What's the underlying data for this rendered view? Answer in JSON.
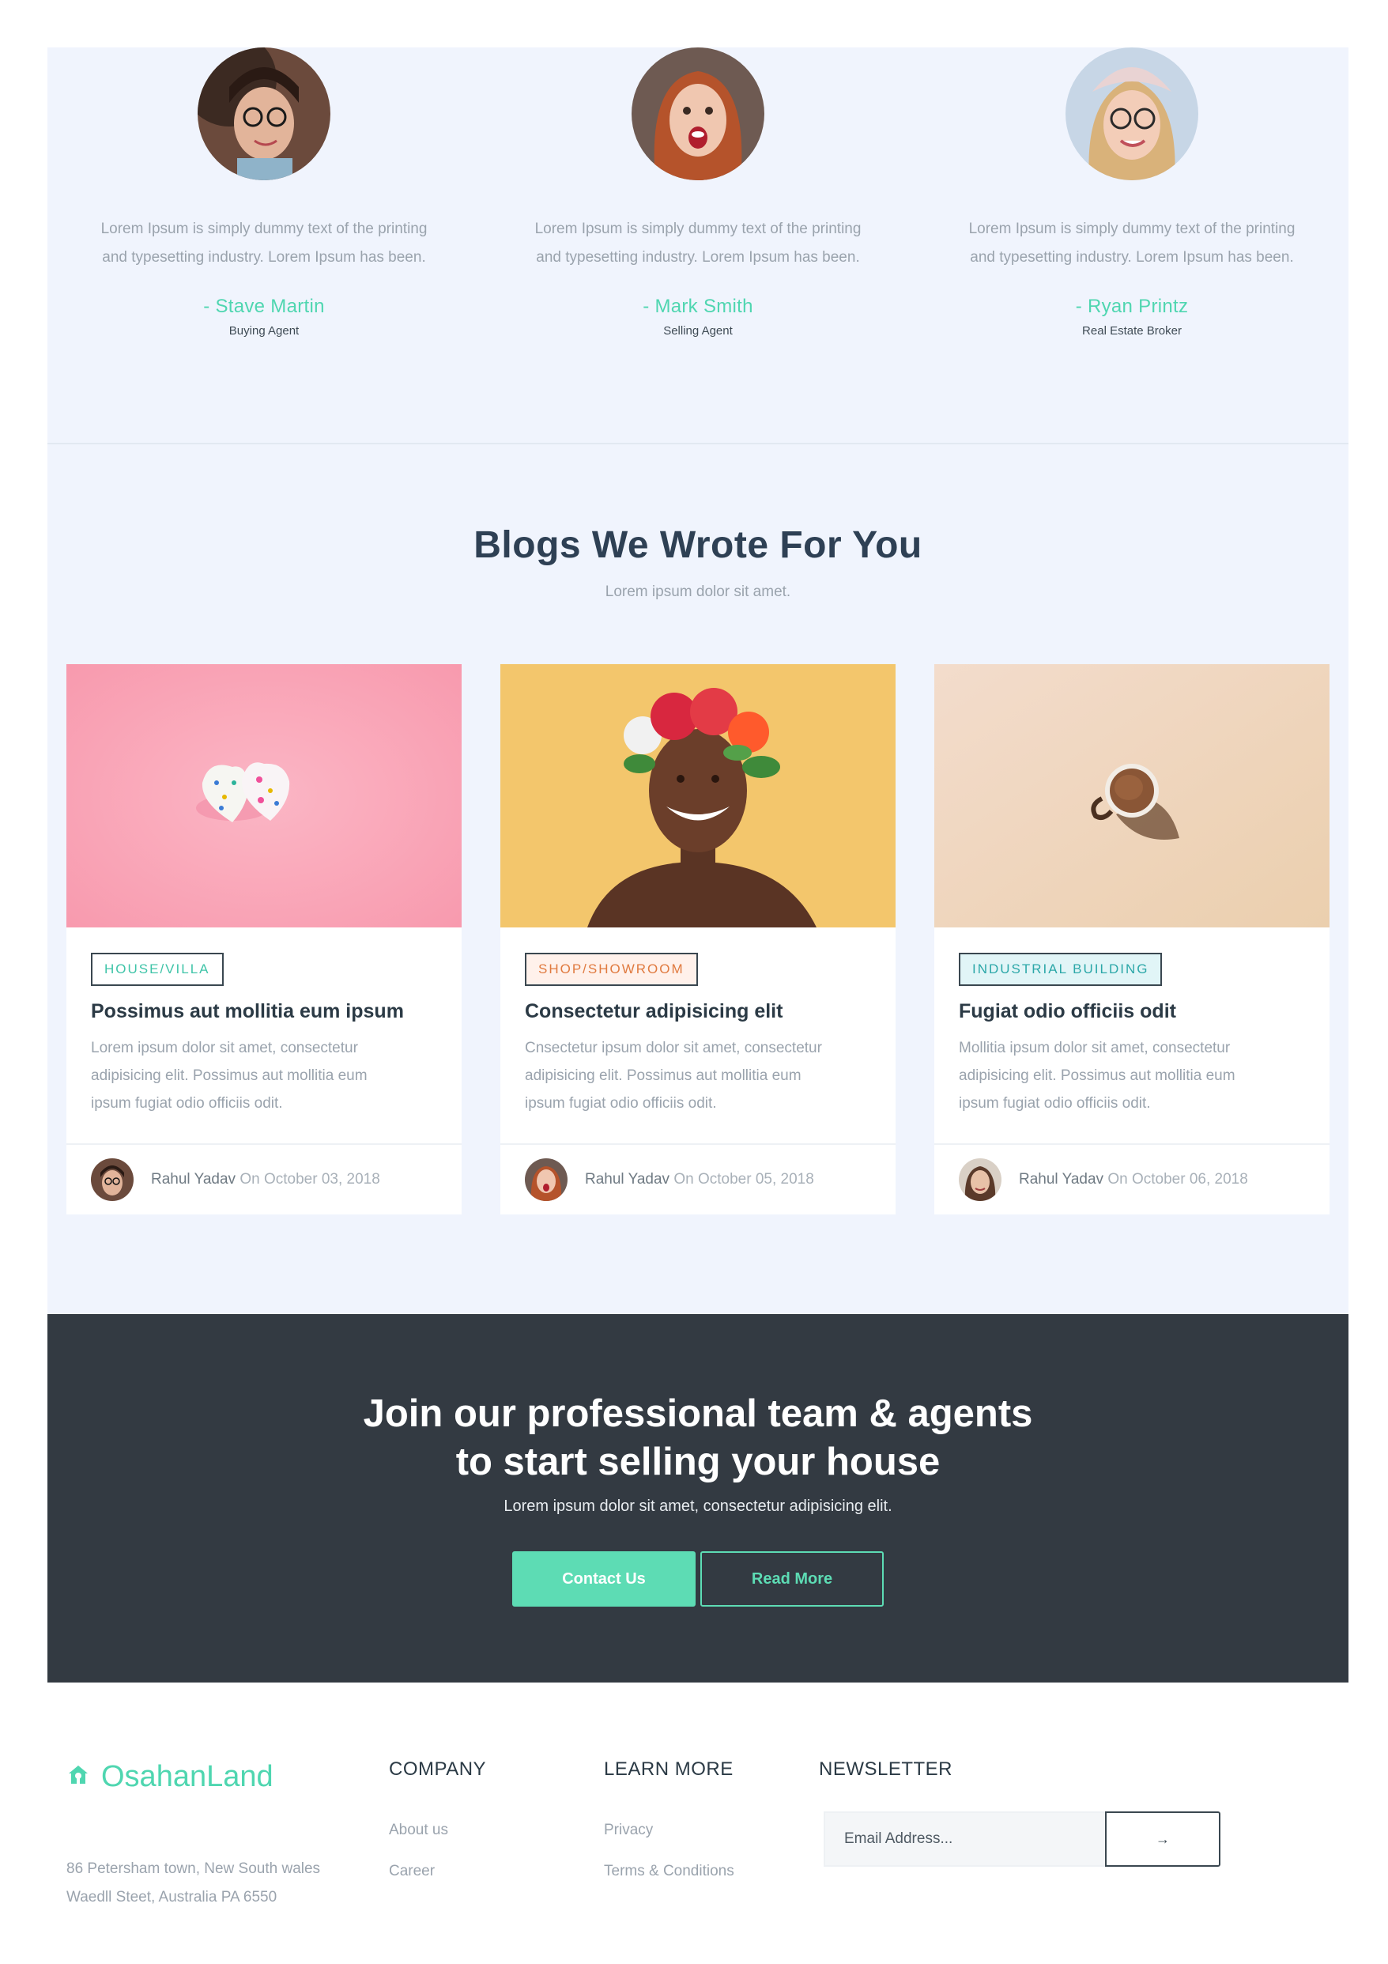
{
  "testimonials": [
    {
      "text_line1": "Lorem Ipsum is simply dummy text of the printing",
      "text_line2": "and typesetting industry. Lorem Ipsum has been.",
      "name": "- Stave Martin",
      "role": "Buying Agent"
    },
    {
      "text_line1": "Lorem Ipsum is simply dummy text of the printing",
      "text_line2": "and typesetting industry. Lorem Ipsum has been.",
      "name": "- Mark Smith",
      "role": "Selling Agent"
    },
    {
      "text_line1": "Lorem Ipsum is simply dummy text of the printing",
      "text_line2": "and typesetting industry. Lorem Ipsum has been.",
      "name": "- Ryan Printz",
      "role": "Real Estate Broker"
    }
  ],
  "blogs": {
    "title": "Blogs We Wrote For You",
    "subtitle": "Lorem ipsum dolor sit amet.",
    "posts": [
      {
        "tag": "HOUSE/VILLA",
        "title": "Possimus aut mollitia eum ipsum",
        "text_line1": "Lorem ipsum dolor sit amet, consectetur",
        "text_line2": "adipisicing elit. Possimus aut mollitia eum",
        "text_line3": "ipsum fugiat odio officiis odit.",
        "author": "Rahul Yadav",
        "date": "On October 03, 2018"
      },
      {
        "tag": "SHOP/SHOWROOM",
        "title": "Consectetur adipisicing elit",
        "text_line1": "Cnsectetur ipsum dolor sit amet, consectetur",
        "text_line2": "adipisicing elit. Possimus aut mollitia eum",
        "text_line3": "ipsum fugiat odio officiis odit.",
        "author": "Rahul Yadav",
        "date": "On October 05, 2018"
      },
      {
        "tag": "INDUSTRIAL BUILDING",
        "title": "Fugiat odio officiis odit",
        "text_line1": "Mollitia ipsum dolor sit amet, consectetur",
        "text_line2": "adipisicing elit. Possimus aut mollitia eum",
        "text_line3": "ipsum fugiat odio officiis odit.",
        "author": "Rahul Yadav",
        "date": "On October 06, 2018"
      }
    ]
  },
  "cta": {
    "title_line1": "Join our professional team & agents",
    "title_line2": "to start selling your house",
    "subtitle": "Lorem ipsum dolor sit amet, consectetur adipisicing elit.",
    "primary_label": "Contact Us",
    "secondary_label": "Read More"
  },
  "footer": {
    "brand": "OsahanLand",
    "address_line1": "86 Petersham town, New South wales",
    "address_line2": "Waedll Steet, Australia PA 6550",
    "company": {
      "heading": "COMPANY",
      "links": [
        "About us",
        "Career"
      ]
    },
    "learn_more": {
      "heading": "LEARN MORE",
      "links": [
        "Privacy",
        "Terms & Conditions"
      ]
    },
    "newsletter": {
      "heading": "NEWSLETTER",
      "placeholder": "Email Address...",
      "submit_icon": "→"
    }
  },
  "colors": {
    "accent": "#5ddcb4",
    "dark": "#333a42",
    "section_bg": "#f0f4fd"
  }
}
